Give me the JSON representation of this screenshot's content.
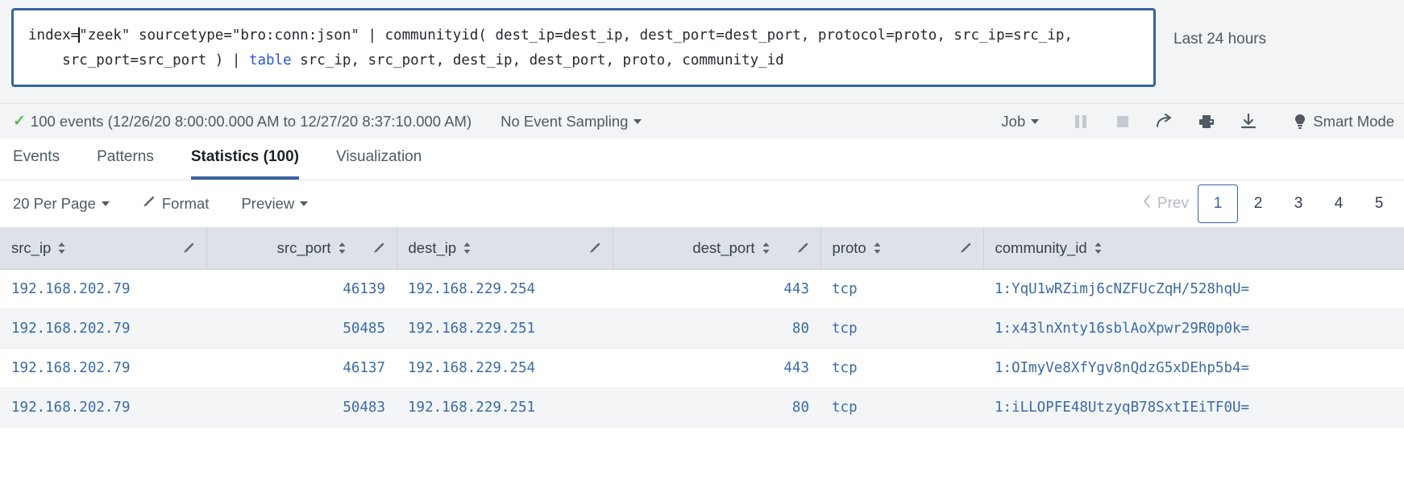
{
  "search": {
    "query_part1": "index=",
    "query_part2": "\"zeek\" sourcetype=\"bro:conn:json\" | communityid( dest_ip=dest_ip, dest_port=dest_port, protocol=proto, src_ip=src_ip,\n    src_port=src_port ) | ",
    "command_keyword": "table",
    "query_part3": " src_ip, src_port, dest_ip, dest_port, proto, community_id",
    "time_range": "Last 24 hours"
  },
  "jobbar": {
    "event_count": "100 events (12/26/20 8:00:00.000 AM to 12/27/20 8:37:10.000 AM)",
    "check_mark": "✓",
    "sampling": "No Event Sampling",
    "job_label": "Job",
    "mode_label": "Smart Mode"
  },
  "tabs": [
    {
      "label": "Events",
      "active": false
    },
    {
      "label": "Patterns",
      "active": false
    },
    {
      "label": "Statistics (100)",
      "active": true
    },
    {
      "label": "Visualization",
      "active": false
    }
  ],
  "results_toolbar": {
    "per_page": "20 Per Page",
    "format": "Format",
    "preview": "Preview"
  },
  "pagination": {
    "prev": "Prev",
    "pages": [
      "1",
      "2",
      "3",
      "4",
      "5"
    ],
    "active_page": "1"
  },
  "table": {
    "columns": [
      {
        "name": "src_ip",
        "align": "left"
      },
      {
        "name": "src_port",
        "align": "right"
      },
      {
        "name": "dest_ip",
        "align": "left"
      },
      {
        "name": "dest_port",
        "align": "right"
      },
      {
        "name": "proto",
        "align": "left"
      },
      {
        "name": "community_id",
        "align": "left"
      }
    ],
    "rows": [
      {
        "src_ip": "192.168.202.79",
        "src_port": "46139",
        "dest_ip": "192.168.229.254",
        "dest_port": "443",
        "proto": "tcp",
        "community_id": "1:YqU1wRZimj6cNZFUcZqH/528hqU="
      },
      {
        "src_ip": "192.168.202.79",
        "src_port": "50485",
        "dest_ip": "192.168.229.251",
        "dest_port": "80",
        "proto": "tcp",
        "community_id": "1:x43lnXnty16sblAoXpwr29R0p0k="
      },
      {
        "src_ip": "192.168.202.79",
        "src_port": "46137",
        "dest_ip": "192.168.229.254",
        "dest_port": "443",
        "proto": "tcp",
        "community_id": "1:OImyVe8XfYgv8nQdzG5xDEhp5b4="
      },
      {
        "src_ip": "192.168.202.79",
        "src_port": "50483",
        "dest_ip": "192.168.229.251",
        "dest_port": "80",
        "proto": "tcp",
        "community_id": "1:iLLOPFE48UtzyqB78SxtIEiTF0U="
      }
    ]
  },
  "colors": {
    "accent": "#3863a0",
    "link": "#3a6ba5",
    "text": "#4f5a64",
    "header_bg": "#dee2e8",
    "success": "#5cb85c"
  }
}
